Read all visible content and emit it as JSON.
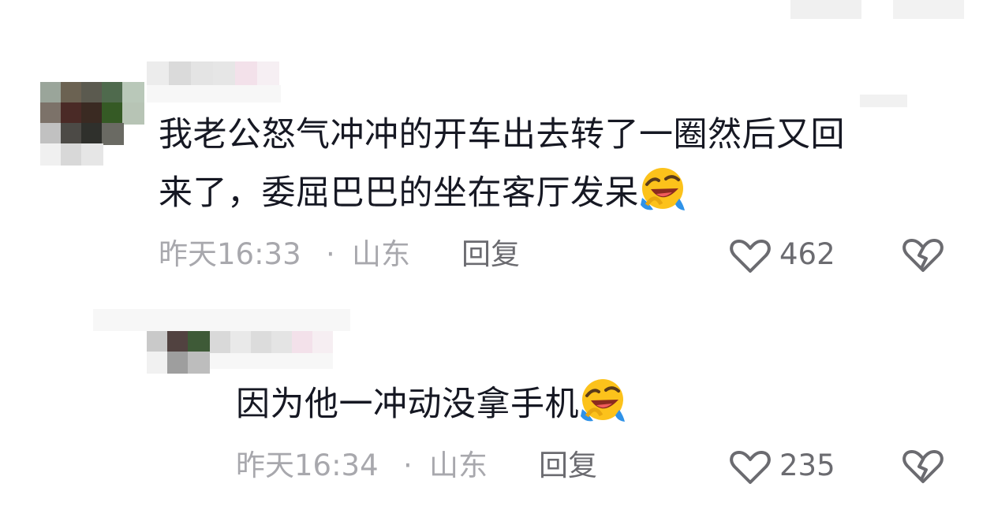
{
  "comments": [
    {
      "text_lines": [
        "我老公怒气冲冲的开车出去转了一圈然后又回",
        "来了，委屈巴巴的坐在客厅发呆"
      ],
      "emoji": "crying-laughing-emoji",
      "time": "昨天16:33",
      "separator": "·",
      "location": "山东",
      "reply_label": "回复",
      "like_count": "462"
    },
    {
      "text_lines": [
        "因为他一冲动没拿手机"
      ],
      "emoji": "crying-laughing-emoji",
      "time": "昨天16:34",
      "separator": "·",
      "location": "山东",
      "reply_label": "回复",
      "like_count": "235"
    }
  ],
  "colors": {
    "text": "#161823",
    "meta": "#a8a8ad",
    "action": "#6b6b70"
  },
  "icons": [
    "heart-outline-icon",
    "broken-heart-icon"
  ]
}
